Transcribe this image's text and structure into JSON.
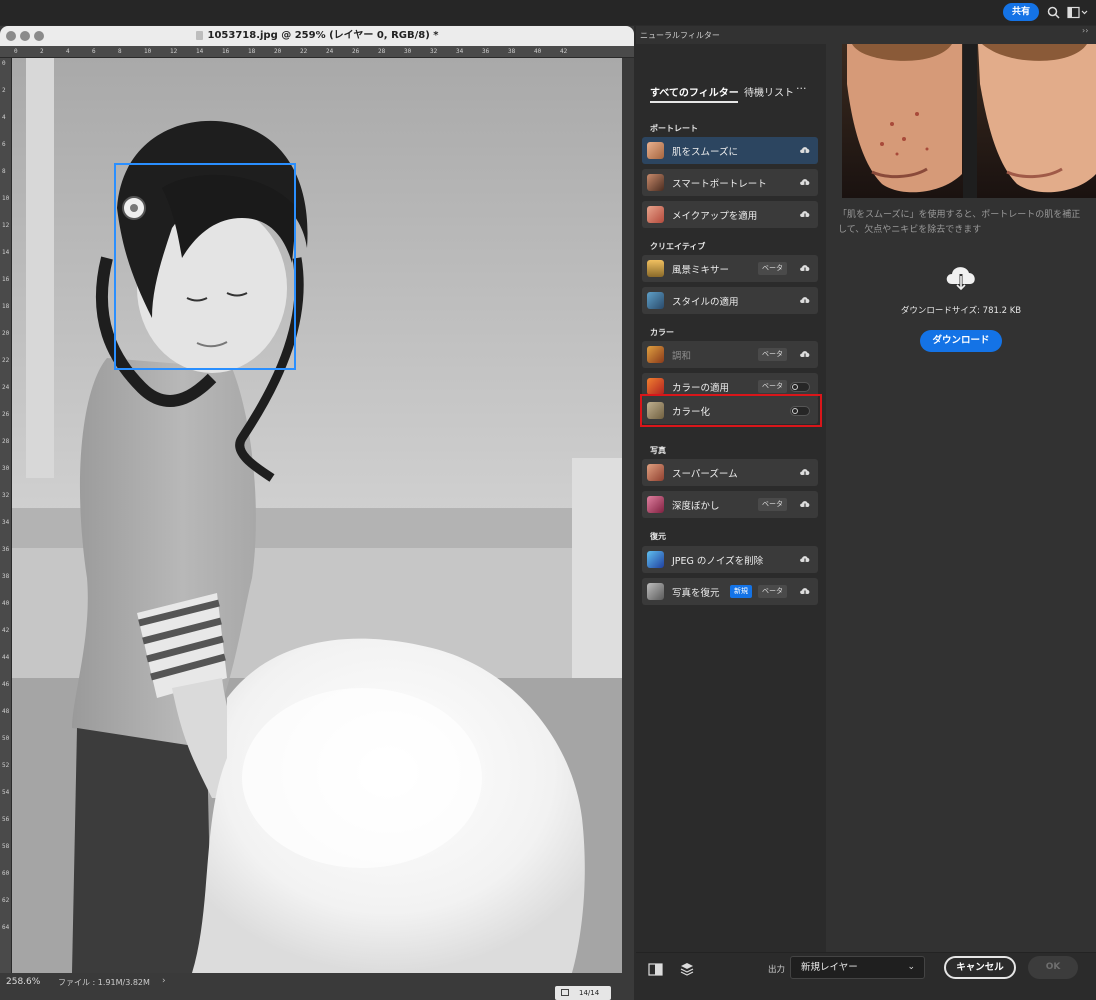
{
  "topbar": {
    "share_label": "共有"
  },
  "document": {
    "title": "1053718.jpg @ 259% (レイヤー 0, RGB/8) *",
    "top_ruler_ticks": [
      "0",
      "2",
      "4",
      "6",
      "8",
      "10",
      "12",
      "14",
      "16",
      "18",
      "20",
      "22",
      "24",
      "26",
      "28",
      "30",
      "32",
      "34",
      "36",
      "38",
      "40",
      "42"
    ],
    "left_ruler_ticks": [
      "0",
      "2",
      "4",
      "6",
      "8",
      "10",
      "12",
      "14",
      "16",
      "18",
      "20",
      "22",
      "24",
      "26",
      "28",
      "30",
      "32",
      "34",
      "36",
      "38",
      "40",
      "42",
      "44",
      "46",
      "48",
      "50",
      "52",
      "54",
      "56",
      "58",
      "60",
      "62",
      "64"
    ],
    "zoom": "258.6%",
    "file_info": "ファイル : 1.91M/3.82M",
    "status_arrow": "›",
    "history_count": "14/14"
  },
  "panel": {
    "tab_title": "ニューラルフィルター",
    "collapse_glyph": "››",
    "tabs": {
      "all": "すべてのフィルター",
      "waitlist": "待機リスト",
      "more": "···"
    },
    "sections": {
      "portrait": "ポートレート",
      "creative": "クリエイティブ",
      "color": "カラー",
      "photo": "写真",
      "restore": "復元"
    },
    "filters": {
      "skin_smoothing": {
        "label": "肌をスムーズに"
      },
      "smart_portrait": {
        "label": "スマートポートレート"
      },
      "makeup_transfer": {
        "label": "メイクアップを適用"
      },
      "landscape_mixer": {
        "label": "風景ミキサー",
        "badge": "ベータ"
      },
      "style_transfer": {
        "label": "スタイルの適用"
      },
      "harmonization": {
        "label": "調和",
        "badge": "ベータ"
      },
      "color_transfer": {
        "label": "カラーの適用",
        "badge": "ベータ"
      },
      "colorize": {
        "label": "カラー化"
      },
      "super_zoom": {
        "label": "スーパーズーム"
      },
      "depth_blur": {
        "label": "深度ぼかし",
        "badge": "ベータ"
      },
      "jpeg_artifacts": {
        "label": "JPEG のノイズを削除"
      },
      "photo_restoration": {
        "label": "写真を復元",
        "badge_new": "新規",
        "badge": "ベータ"
      }
    },
    "detail": {
      "description": "「肌をスムーズに」を使用すると、ポートレートの肌を補正して、欠点やニキビを除去できます",
      "download_size": "ダウンロードサイズ: 781.2 KB",
      "download_label": "ダウンロード"
    },
    "bottom": {
      "output_label": "出力",
      "output_value": "新規レイヤー",
      "cancel_label": "キャンセル",
      "ok_label": "OK"
    }
  },
  "colors": {
    "accent": "#1473e6",
    "selection": "#2a8fff",
    "highlight": "#d9161a"
  }
}
